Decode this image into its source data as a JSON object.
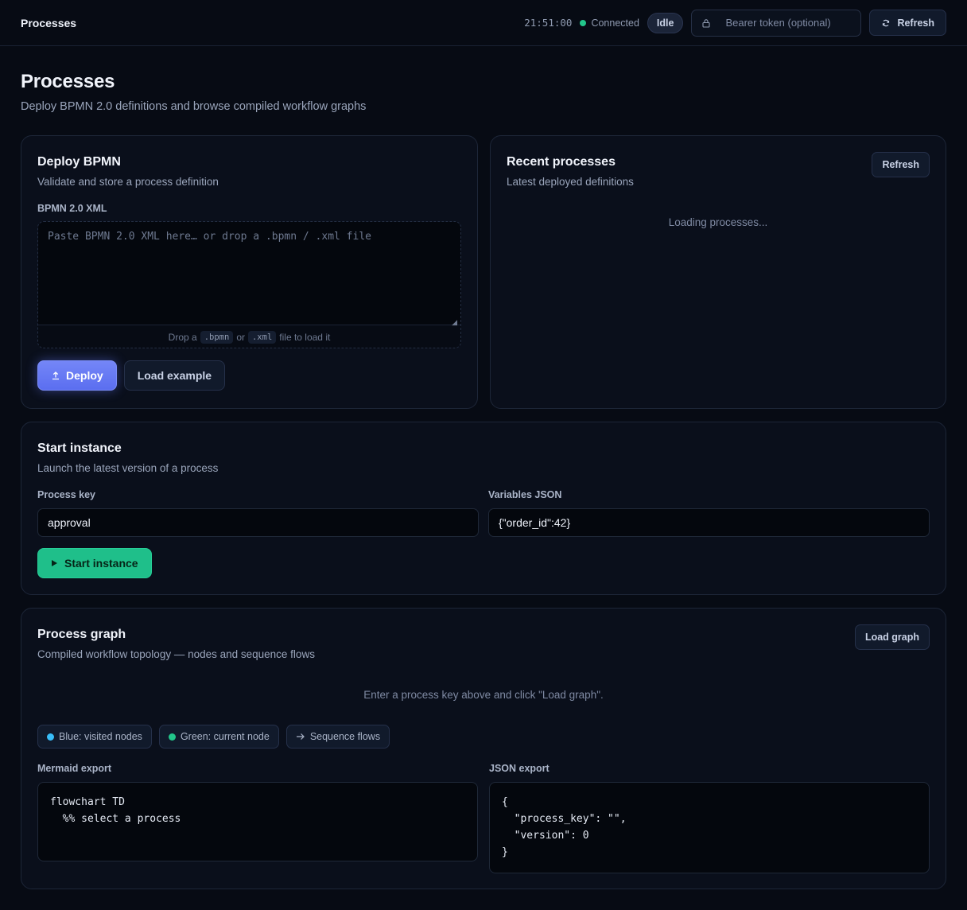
{
  "topbar": {
    "title": "Processes",
    "time": "21:51:00",
    "connection": "Connected",
    "status_badge": "Idle",
    "token_placeholder": "Bearer token (optional)",
    "refresh_label": "Refresh",
    "colors": {
      "connected": "#22c58a"
    }
  },
  "page": {
    "title": "Processes",
    "subtitle": "Deploy BPMN 2.0 definitions and browse compiled workflow graphs"
  },
  "deploy": {
    "title": "Deploy BPMN",
    "subtitle": "Validate and store a process definition",
    "field_label": "BPMN 2.0 XML",
    "placeholder": "Paste BPMN 2.0 XML here… or drop a .bpmn / .xml file",
    "drop_hint_prefix": "Drop a",
    "drop_ext1": ".bpmn",
    "drop_or": "or",
    "drop_ext2": ".xml",
    "drop_hint_suffix": "file to load it",
    "deploy_label": "Deploy",
    "load_example_label": "Load example"
  },
  "recent": {
    "title": "Recent processes",
    "subtitle": "Latest deployed definitions",
    "refresh_label": "Refresh",
    "loading_text": "Loading processes..."
  },
  "start": {
    "title": "Start instance",
    "subtitle": "Launch the latest version of a process",
    "process_key_label": "Process key",
    "process_key_value": "approval",
    "variables_label": "Variables JSON",
    "variables_value": "{\"order_id\":42}",
    "start_label": "Start instance"
  },
  "graph": {
    "title": "Process graph",
    "subtitle": "Compiled workflow topology — nodes and sequence flows",
    "load_graph_label": "Load graph",
    "empty_text": "Enter a process key above and click \"Load graph\".",
    "legend": [
      {
        "label": "Blue: visited nodes",
        "color": "#38bdf8"
      },
      {
        "label": "Green: current node",
        "color": "#22c58a"
      },
      {
        "label": "Sequence flows",
        "icon": "arrow-right-icon"
      }
    ],
    "mermaid_label": "Mermaid export",
    "mermaid_code": "flowchart TD\n  %% select a process",
    "json_label": "JSON export",
    "json_code": "{\n  \"process_key\": \"\",\n  \"version\": 0\n}"
  }
}
